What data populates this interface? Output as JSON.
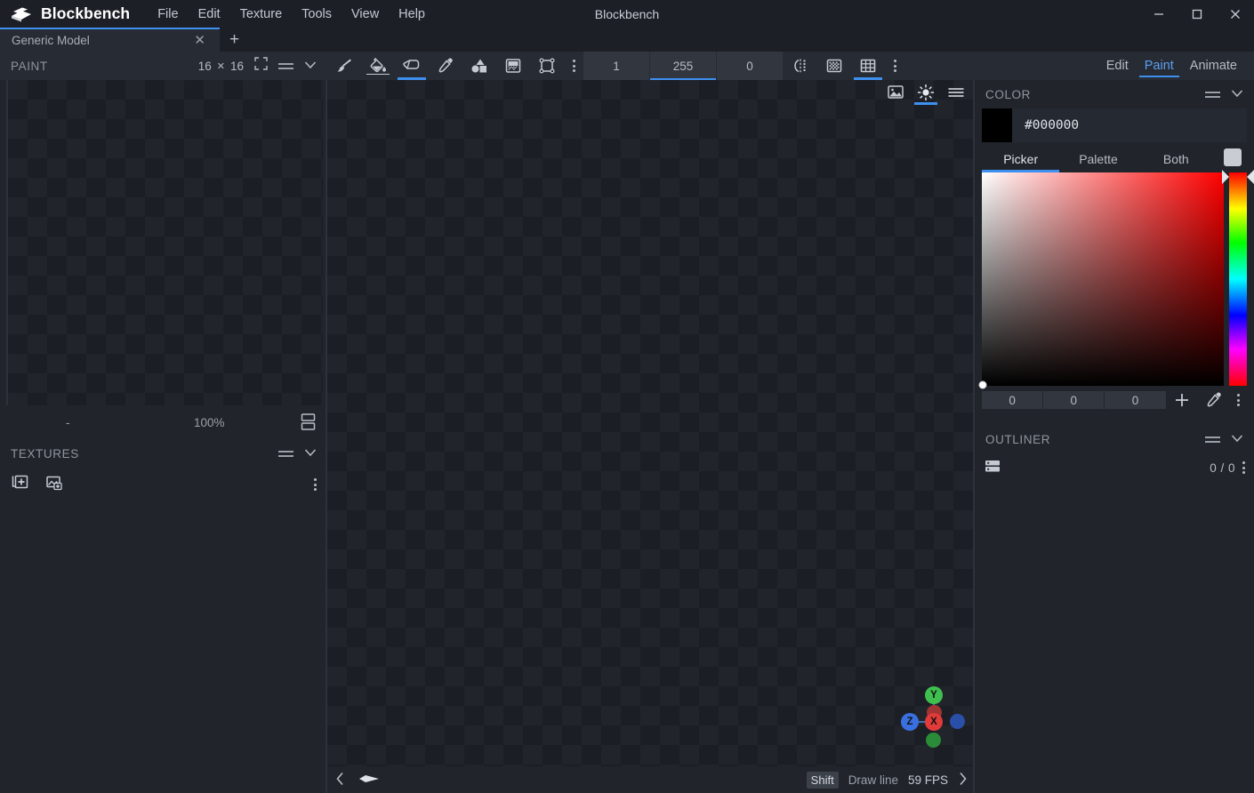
{
  "titlebar": {
    "app_name": "Blockbench",
    "window_title": "Blockbench",
    "menus": [
      "File",
      "Edit",
      "Texture",
      "Tools",
      "View",
      "Help"
    ],
    "controls": {
      "minimize": "minimize-icon",
      "maximize": "maximize-icon",
      "close": "close-icon"
    }
  },
  "tabs": {
    "items": [
      {
        "label": "Generic Model",
        "close": "✕"
      }
    ],
    "add_label": "+"
  },
  "left_panel": {
    "title": "PAINT",
    "resolution": {
      "width": "16",
      "separator": "✕",
      "height": "16"
    },
    "header_icons": [
      "fullscreen-icon",
      "drag-handle-icon",
      "collapse-chevron-icon"
    ],
    "status": {
      "name": "-",
      "zoom": "100%",
      "layout_icon": "split-view-icon"
    },
    "textures": {
      "title": "TEXTURES",
      "header_icons": [
        "drag-handle-icon",
        "collapse-chevron-icon"
      ],
      "actions": [
        "add-texture-icon",
        "create-texture-icon",
        "more-options-icon"
      ],
      "items": []
    }
  },
  "toolbar": {
    "tools": [
      {
        "name": "brush-tool",
        "icon": "brush-icon",
        "active": false
      },
      {
        "name": "fill-tool",
        "icon": "paint-bucket-icon",
        "active": false
      },
      {
        "name": "eraser-tool",
        "icon": "eraser-icon",
        "active": true
      },
      {
        "name": "color-picker-tool",
        "icon": "eyedropper-icon",
        "active": false
      },
      {
        "name": "draw-shape-tool",
        "icon": "shapes-icon",
        "active": false
      },
      {
        "name": "gradient-tool",
        "icon": "gradient-icon",
        "active": false
      },
      {
        "name": "copy-paste-tool",
        "icon": "selection-frame-icon",
        "active": false
      }
    ],
    "tool_overflow": "more-tools-icon",
    "fields": [
      {
        "name": "brush-size",
        "value": "1",
        "selected": false
      },
      {
        "name": "brush-opacity",
        "value": "255",
        "selected": true
      },
      {
        "name": "brush-softness",
        "value": "0",
        "selected": false
      }
    ],
    "toggles": [
      {
        "name": "mirror-painting",
        "icon": "mirror-icon",
        "active": false
      },
      {
        "name": "pixel-grid",
        "icon": "checker-icon",
        "active": false
      },
      {
        "name": "painting-grid",
        "icon": "grid-icon",
        "active": true
      }
    ],
    "toggle_overflow": "more-options-icon"
  },
  "modes": [
    {
      "label": "Edit",
      "active": false
    },
    {
      "label": "Paint",
      "active": true
    },
    {
      "label": "Animate",
      "active": false
    }
  ],
  "viewport": {
    "tools": [
      {
        "name": "background-image-toggle",
        "icon": "image-icon",
        "active": false
      },
      {
        "name": "brightness-toggle",
        "icon": "sun-icon",
        "active": true
      },
      {
        "name": "viewport-menu",
        "icon": "hamburger-icon",
        "active": false
      }
    ],
    "gizmo": {
      "axes": [
        {
          "label": "Y",
          "color": "#3fbf4f"
        },
        {
          "label": "X",
          "color": "#e03a3a"
        },
        {
          "label": "Z",
          "color": "#3a6fe0"
        }
      ]
    },
    "status": {
      "prev_icon": "chevron-left-icon",
      "next_icon": "chevron-right-icon",
      "cursor_icon": "brush-cursor-icon",
      "shortcut_key": "Shift",
      "shortcut_action": "Draw line",
      "fps": "59 FPS"
    }
  },
  "right_panel": {
    "color": {
      "title": "COLOR",
      "header_icons": [
        "drag-handle-icon",
        "collapse-chevron-icon"
      ],
      "hex_value": "#000000",
      "swatch_color": "#000000",
      "tabs": [
        {
          "label": "Picker",
          "active": true
        },
        {
          "label": "Palette",
          "active": false
        },
        {
          "label": "Both",
          "active": false
        }
      ],
      "quick_swatch": "#c9ccd3",
      "channels": [
        {
          "name": "red-channel",
          "value": "0"
        },
        {
          "name": "green-channel",
          "value": "0"
        },
        {
          "name": "blue-channel",
          "value": "0"
        }
      ],
      "actions": [
        "add-swatch-icon",
        "pick-screen-color-icon",
        "color-more-options-icon"
      ]
    },
    "outliner": {
      "title": "OUTLINER",
      "header_icons": [
        "drag-handle-icon",
        "collapse-chevron-icon"
      ],
      "list_icon": "outliner-list-icon",
      "count": "0 / 0",
      "more_icon": "more-options-icon",
      "items": []
    }
  },
  "theme": {
    "accent": "#3e90f0",
    "background": "#21252b",
    "panel": "#272b33",
    "titlebar": "#1c1f26",
    "text": "#b7bcc4"
  }
}
